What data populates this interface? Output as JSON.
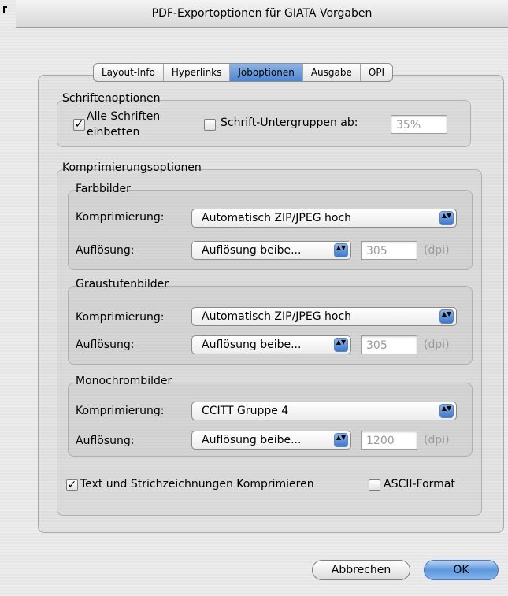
{
  "window": {
    "title": "PDF-Exportoptionen für GIATA Vorgaben"
  },
  "tabs": [
    {
      "label": "Layout-Info",
      "active": false
    },
    {
      "label": "Hyperlinks",
      "active": false
    },
    {
      "label": "Joboptionen",
      "active": true
    },
    {
      "label": "Ausgabe",
      "active": false
    },
    {
      "label": "OPI",
      "active": false
    }
  ],
  "fonts": {
    "title": "Schriftenoptionen",
    "embed_all": {
      "label_line1": "Alle Schriften",
      "label_line2": "einbetten",
      "checked": true
    },
    "subset": {
      "label": "Schrift-Untergruppen ab:",
      "checked": false,
      "value": "35%"
    }
  },
  "compression": {
    "title": "Komprimierungsoptionen",
    "color": {
      "title": "Farbbilder",
      "compression_label": "Komprimierung:",
      "compression_value": "Automatisch ZIP/JPEG hoch",
      "resolution_label": "Auflösung:",
      "resolution_value": "Auflösung beibe...",
      "dpi_value": "305",
      "dpi_unit": "(dpi)"
    },
    "gray": {
      "title": "Graustufenbilder",
      "compression_label": "Komprimierung:",
      "compression_value": "Automatisch ZIP/JPEG hoch",
      "resolution_label": "Auflösung:",
      "resolution_value": "Auflösung beibe...",
      "dpi_value": "305",
      "dpi_unit": "(dpi)"
    },
    "mono": {
      "title": "Monochrombilder",
      "compression_label": "Komprimierung:",
      "compression_value": "CCITT Gruppe 4",
      "resolution_label": "Auflösung:",
      "resolution_value": "Auflösung beibe...",
      "dpi_value": "1200",
      "dpi_unit": "(dpi)"
    },
    "text_line_art": {
      "label": "Text und Strichzeichnungen Komprimieren",
      "checked": true
    },
    "ascii": {
      "label": "ASCII-Format",
      "checked": false
    }
  },
  "buttons": {
    "cancel": "Abbrechen",
    "ok": "OK"
  },
  "icons": {
    "check": "✓",
    "popup_arrows": "▲▼"
  }
}
